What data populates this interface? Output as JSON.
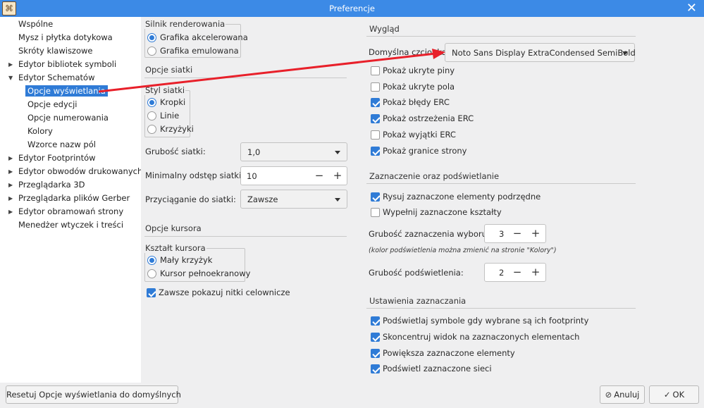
{
  "window": {
    "title": "Preferencje",
    "app_icon": "kicad-app-icon",
    "close_icon": "close-icon"
  },
  "tree": {
    "items": [
      {
        "label": "Wspólne",
        "expanded": null
      },
      {
        "label": "Mysz i płytka dotykowa",
        "expanded": null
      },
      {
        "label": "Skróty klawiszowe",
        "expanded": null
      },
      {
        "label": "Edytor bibliotek symboli",
        "expanded": false
      },
      {
        "label": "Edytor Schematów",
        "expanded": true
      },
      {
        "label": "Opcje wyświetlania",
        "selected": true
      },
      {
        "label": "Opcje edycji"
      },
      {
        "label": "Opcje numerowania"
      },
      {
        "label": "Kolory"
      },
      {
        "label": "Wzorce nazw pól"
      },
      {
        "label": "Edytor Footprintów",
        "expanded": false
      },
      {
        "label": "Edytor obwodów drukowanych",
        "expanded": false
      },
      {
        "label": "Przeglądarka 3D",
        "expanded": false
      },
      {
        "label": "Przeglądarka plików Gerber",
        "expanded": false
      },
      {
        "label": "Edytor obramowań strony",
        "expanded": false
      },
      {
        "label": "Menedżer wtyczek i treści",
        "expanded": null
      }
    ]
  },
  "rendering": {
    "title": "Silnik renderowania",
    "options": [
      {
        "label": "Grafika akcelerowana",
        "selected": true
      },
      {
        "label": "Grafika emulowana",
        "selected": false
      }
    ]
  },
  "grid": {
    "title": "Opcje siatki",
    "style_title": "Styl siatki",
    "styles": [
      {
        "label": "Kropki",
        "selected": true
      },
      {
        "label": "Linie",
        "selected": false
      },
      {
        "label": "Krzyżyki",
        "selected": false
      }
    ],
    "thickness_label": "Grubość siatki:",
    "thickness_value": "1,0",
    "min_spacing_label": "Minimalny odstęp siatki:",
    "min_spacing_value": "10",
    "snap_label": "Przyciąganie do siatki:",
    "snap_value": "Zawsze"
  },
  "cursor": {
    "title": "Opcje kursora",
    "shape_title": "Kształt kursora",
    "shapes": [
      {
        "label": "Mały krzyżyk",
        "selected": true
      },
      {
        "label": "Kursor pełnoekranowy",
        "selected": false
      }
    ],
    "always_crosshair": {
      "label": "Zawsze pokazuj nitki celownicze",
      "checked": true
    }
  },
  "appearance": {
    "title": "Wygląd",
    "font_label": "Domyślna czcionka:",
    "font_value": "Noto Sans Display ExtraCondensed SemiBold",
    "checks": [
      {
        "label": "Pokaż ukryte piny",
        "checked": false
      },
      {
        "label": "Pokaż ukryte pola",
        "checked": false
      },
      {
        "label": "Pokaż błędy ERC",
        "checked": true
      },
      {
        "label": "Pokaż ostrzeżenia ERC",
        "checked": true
      },
      {
        "label": "Pokaż wyjątki ERC",
        "checked": false
      },
      {
        "label": "Pokaż granice strony",
        "checked": true
      }
    ]
  },
  "highlight": {
    "title": "Zaznaczenie oraz podświetlanie",
    "checks": [
      {
        "label": "Rysuj zaznaczone elementy podrzędne",
        "checked": true
      },
      {
        "label": "Wypełnij zaznaczone kształty",
        "checked": false
      }
    ],
    "sel_thickness_label": "Grubość zaznaczenia wyboru:",
    "sel_thickness_value": "3",
    "note": "(kolor podświetlenia można zmienić na stronie \"Kolory\")",
    "hl_thickness_label": "Grubość podświetlenia:",
    "hl_thickness_value": "2"
  },
  "selection": {
    "title": "Ustawienia zaznaczania",
    "checks": [
      {
        "label": "Podświetlaj symbole gdy wybrane są ich footprinty",
        "checked": true
      },
      {
        "label": "Skoncentruj widok na zaznaczonych elementach",
        "checked": true
      },
      {
        "label": "Powiększa zaznaczone elementy",
        "checked": true
      },
      {
        "label": "Podświetl zaznaczone sieci",
        "checked": true
      }
    ]
  },
  "buttons": {
    "reset": "Resetuj Opcje wyświetlania do domyślnych",
    "cancel": "Anuluj",
    "ok": "OK"
  },
  "colors": {
    "accent": "#2f7bd6",
    "titlebar": "#3c8ae6",
    "annotation_arrow": "#e8202a"
  }
}
